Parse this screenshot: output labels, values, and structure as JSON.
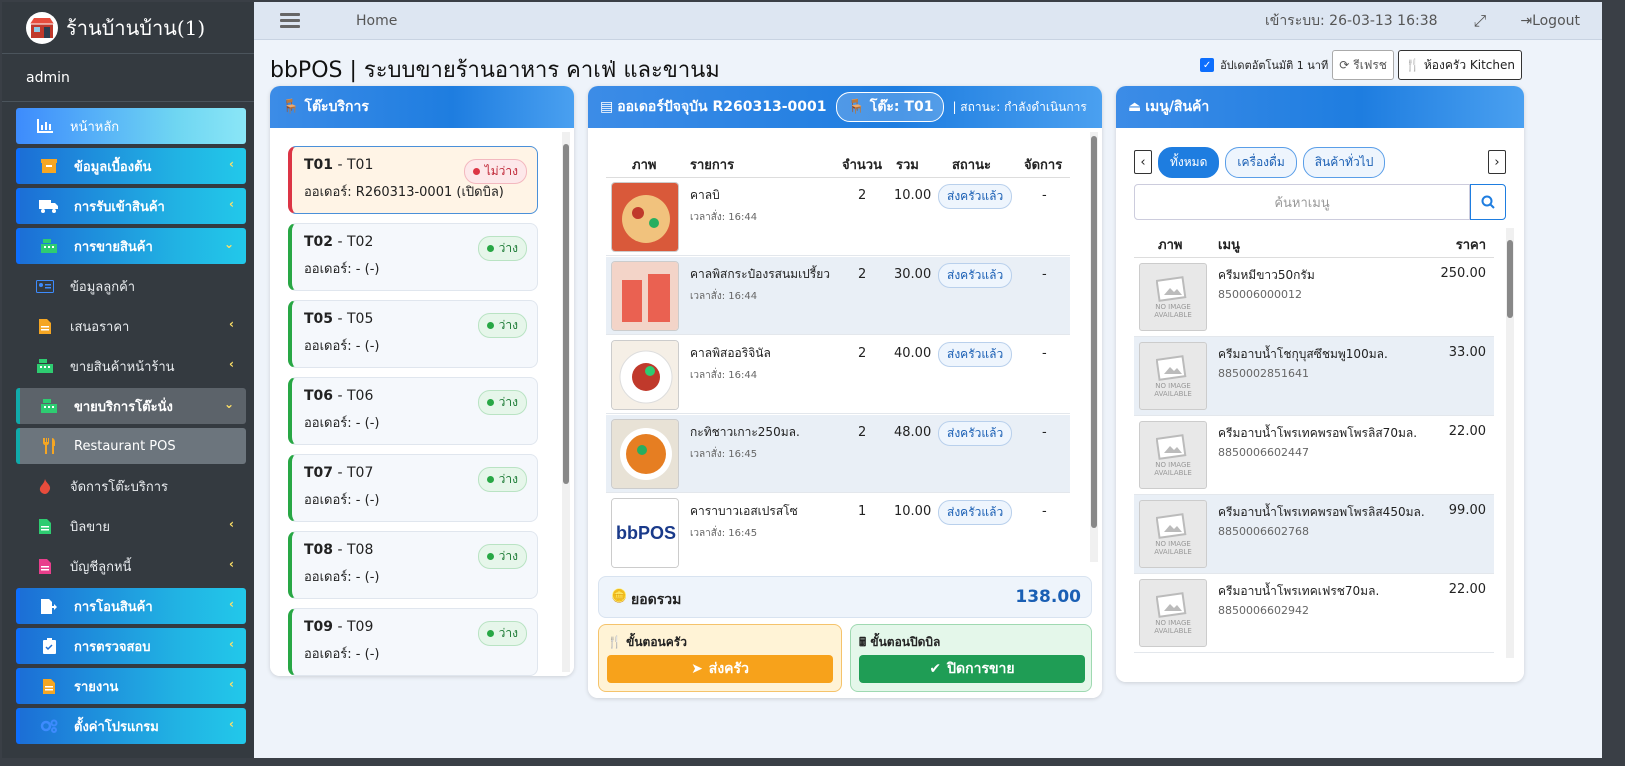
{
  "brand": {
    "name": "ร้านบ้านบ้าน(1)",
    "user": "admin"
  },
  "nav": [
    {
      "label": "หน้าหลัก",
      "icon": "chart-icon"
    },
    {
      "label": "ข้อมูลเบื้องต้น",
      "icon": "box-icon"
    },
    {
      "label": "การรับเข้าสินค้า",
      "icon": "truck-icon"
    },
    {
      "label": "การขายสินค้า",
      "icon": "register-icon"
    },
    {
      "label": "ข้อมูลลูกค้า",
      "icon": "id-card-icon"
    },
    {
      "label": "เสนอราคา",
      "icon": "file-icon"
    },
    {
      "label": "ขายสินค้าหน้าร้าน",
      "icon": "register-icon"
    },
    {
      "label": "ขายบริการโต๊ะนั่ง",
      "icon": "register-icon"
    },
    {
      "label": "Restaurant POS",
      "icon": "utensils-icon"
    },
    {
      "label": "จัดการโต๊ะบริการ",
      "icon": "fire-icon"
    },
    {
      "label": "บิลขาย",
      "icon": "file-icon"
    },
    {
      "label": "บัญชีลูกหนี้",
      "icon": "file-pdf-icon"
    },
    {
      "label": "การโอนสินค้า",
      "icon": "transfer-icon"
    },
    {
      "label": "การตรวจสอบ",
      "icon": "clipboard-check-icon"
    },
    {
      "label": "รายงาน",
      "icon": "report-icon"
    },
    {
      "label": "ตั้งค่าโปรแกรม",
      "icon": "gears-icon"
    }
  ],
  "topbar": {
    "home": "Home",
    "login_time": "เข้าระบบ: 26-03-13 16:38",
    "logout": "Logout"
  },
  "page": {
    "title": "bbPOS | ระบบขายร้านอาหาร คาเฟ่ และขานม",
    "auto_refresh": "อัปเดตอัตโนมัติ 1 นาที",
    "refresh_btn": "รีเฟรช",
    "kitchen_btn": "ห้องครัว Kitchen"
  },
  "tables_panel": {
    "title": "โต๊ะบริการ",
    "tables": [
      {
        "code": "T01",
        "name": "T01",
        "status": "ไม่ว่าง",
        "order": "ออเดอร์: R260313-0001 (เปิดบิล)",
        "busy": true
      },
      {
        "code": "T02",
        "name": "T02",
        "status": "ว่าง",
        "order": "ออเดอร์: - (-)",
        "busy": false
      },
      {
        "code": "T05",
        "name": "T05",
        "status": "ว่าง",
        "order": "ออเดอร์: - (-)",
        "busy": false
      },
      {
        "code": "T06",
        "name": "T06",
        "status": "ว่าง",
        "order": "ออเดอร์: - (-)",
        "busy": false
      },
      {
        "code": "T07",
        "name": "T07",
        "status": "ว่าง",
        "order": "ออเดอร์: - (-)",
        "busy": false
      },
      {
        "code": "T08",
        "name": "T08",
        "status": "ว่าง",
        "order": "ออเดอร์: - (-)",
        "busy": false
      },
      {
        "code": "T09",
        "name": "T09",
        "status": "ว่าง",
        "order": "ออเดอร์: - (-)",
        "busy": false
      }
    ]
  },
  "order_panel": {
    "title": "ออเดอร์ปัจจุบัน R260313-0001",
    "table_badge": "โต๊ะ: T01",
    "status": "| สถานะ: กำลังดำเนินการ",
    "headers": [
      "ภาพ",
      "รายการ",
      "จำนวน",
      "รวม",
      "สถานะ",
      "จัดการ"
    ],
    "items": [
      {
        "name": "คาลบิ",
        "time": "เวลาสั่ง: 16:44",
        "qty": "2",
        "total": "10.00",
        "status": "ส่งครัวแล้ว",
        "action": "-",
        "img": "food-red"
      },
      {
        "name": "คาลพิสกระป๋องรสนมเปรี้ยว",
        "time": "เวลาสั่ง: 16:44",
        "qty": "2",
        "total": "30.00",
        "status": "ส่งครัวแล้ว",
        "action": "-",
        "img": "drink-red"
      },
      {
        "name": "คาลพิสออริจินัล",
        "time": "เวลาสั่ง: 16:44",
        "qty": "2",
        "total": "40.00",
        "status": "ส่งครัวแล้ว",
        "action": "-",
        "img": "food-plate"
      },
      {
        "name": "กะทิชาวเกาะ250มล.",
        "time": "เวลาสั่ง: 16:45",
        "qty": "2",
        "total": "48.00",
        "status": "ส่งครัวแล้ว",
        "action": "-",
        "img": "food-bowl"
      },
      {
        "name": "คาราบาวเอสเปรสโซ",
        "time": "เวลาสั่ง: 16:45",
        "qty": "1",
        "total": "10.00",
        "status": "ส่งครัวแล้ว",
        "action": "-",
        "img": "logo"
      }
    ],
    "total_label": "ยอดรวม",
    "total_value": "138.00",
    "kitchen_step": "ขั้นตอนครัว",
    "send_kitchen": "ส่งครัว",
    "close_step": "ขั้นตอนปิดบิล",
    "close_sale": "ปิดการขาย"
  },
  "menu_panel": {
    "title": "เมนู/สินค้า",
    "tabs": [
      "ทั้งหมด",
      "เครื่องดื่ม",
      "สินค้าทั่วไป"
    ],
    "search_placeholder": "ค้นหาเมนู",
    "headers": [
      "ภาพ",
      "เมนู",
      "ราคา"
    ],
    "no_image": "NO IMAGE AVAILABLE",
    "items": [
      {
        "name": "ครีมหมีขาว50กรัม",
        "code": "850006000012",
        "price": "250.00"
      },
      {
        "name": "ครีมอาบน้ำโชกุบุสซึชมพู100มล.",
        "code": "8850002851641",
        "price": "33.00"
      },
      {
        "name": "ครีมอาบน้ำโพรเทคพรอพโพรลิส70มล.",
        "code": "8850006602447",
        "price": "22.00"
      },
      {
        "name": "ครีมอาบน้ำโพรเทคพรอพโพรลิส450มล.",
        "code": "8850006602768",
        "price": "99.00"
      },
      {
        "name": "ครีมอาบน้ำโพรเทคเฟรช70มล.",
        "code": "8850006602942",
        "price": "22.00"
      }
    ]
  },
  "colors": {
    "accent": "#1e7de0",
    "free": "#28a745",
    "busy": "#dc3545",
    "orange": "#f7a21b",
    "green": "#1f9d55"
  }
}
